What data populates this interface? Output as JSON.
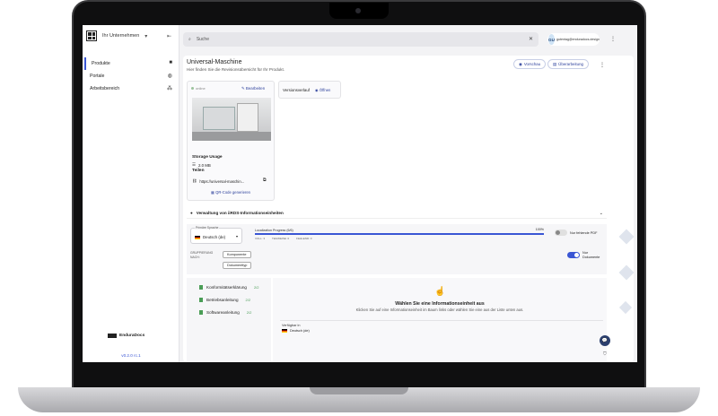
{
  "sidebar": {
    "company": "Ihr Unternehmen",
    "items": [
      {
        "label": "Produkte",
        "icon": "briefcase-icon"
      },
      {
        "label": "Portale",
        "icon": "globe-icon"
      },
      {
        "label": "Arbeitsbereich",
        "icon": "share-nodes-icon"
      }
    ],
    "brand": "EnduraDocs",
    "version": "v0.2.0 rc.1"
  },
  "topbar": {
    "search_placeholder": "Suche",
    "avatar_initials": "GU",
    "user_email": "gutentag@enduradocs.design"
  },
  "header": {
    "title": "Universal-Maschine",
    "subtitle": "Hier finden Sie die Revisionsübersicht für Ihr Produkt.",
    "preview_label": "Vorschau",
    "overview_label": "Überarbeitung"
  },
  "card": {
    "status": "online",
    "edit_label": "Bearbeiten",
    "storage_title": "Storage Usage",
    "storage_value": "2.0 MB",
    "share_title": "Teilen",
    "url": "https://universal-maschin...",
    "qr_label": "QR-Code generieren"
  },
  "versions": {
    "label": "Versionsverlauf",
    "open_label": "Öffnen"
  },
  "accordion": {
    "label": "Verwaltung von iiRDS-Informationseinheiten"
  },
  "filters": {
    "lang_label": "Primäre Sprache",
    "lang_value": "Deutsch (de)",
    "progress_label": "Localization Progress (6/6)",
    "progress_pct": "100%",
    "progress_value": 1.0,
    "legend": [
      "VOLL: 3",
      "TEILWEISE: 0",
      "FEHLEND: 0"
    ],
    "missing_pdf_label": "Nur fehlende PDF",
    "group_label": "GRUPPIERUNG NACH:",
    "chip_component": "Komponente",
    "chip_doctype": "Dokumenttyp",
    "docs_only_label": "Nur Dokumente"
  },
  "tree": [
    {
      "label": "Konformitätserklärung",
      "count": "2/2"
    },
    {
      "label": "Betriebsanleitung",
      "count": "2/2"
    },
    {
      "label": "Softwareanleitung",
      "count": "2/2"
    }
  ],
  "empty": {
    "heading": "Wählen Sie eine Informationseinheit aus",
    "text": "Klicken Sie auf eine Informationseinheit im Baum links oder wählen Sie eine aus der Liste unten aus.",
    "avail_label": "Verfügbar in",
    "avail_lang": "Deutsch (de)"
  },
  "colors": {
    "accent": "#3a56d4",
    "success": "#4a9d56"
  }
}
